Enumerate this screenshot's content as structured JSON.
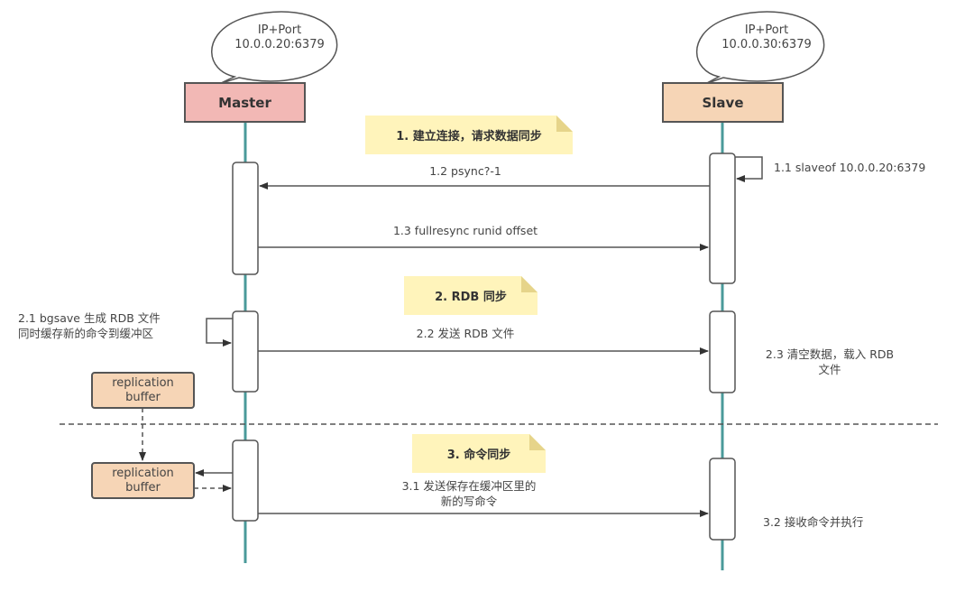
{
  "colors": {
    "master_fill": "#f2b8b5",
    "slave_fill": "#f6d5b6",
    "lifeline": "#4a9a9a",
    "note_fill": "#fff4bb",
    "buffer_fill": "#f6d5b6",
    "line": "#555555"
  },
  "actors": {
    "master": {
      "label": "Master",
      "bubble_line1": "IP+Port",
      "bubble_line2": "10.0.0.20:6379"
    },
    "slave": {
      "label": "Slave",
      "bubble_line1": "IP+Port",
      "bubble_line2": "10.0.0.30:6379"
    }
  },
  "phases": [
    {
      "label": "1. 建立连接，请求数据同步"
    },
    {
      "label": "2. RDB 同步"
    },
    {
      "label": "3. 命令同步"
    }
  ],
  "messages": {
    "m1_1": "1.1 slaveof 10.0.0.20:6379",
    "m1_2": "1.2 psync?-1",
    "m1_3": "1.3 fullresync runid offset",
    "m2_1_line1": "2.1 bgsave 生成 RDB 文件",
    "m2_1_line2": "同时缓存新的命令到缓冲区",
    "m2_2": "2.2 发送 RDB 文件",
    "m2_3_line1": "2.3 清空数据，载入 RDB",
    "m2_3_line2": "文件",
    "m3_1_line1": "3.1 发送保存在缓冲区里的",
    "m3_1_line2": "新的写命令",
    "m3_2": "3.2 接收命令并执行"
  },
  "buffers": [
    {
      "line1": "replication",
      "line2": "buffer"
    },
    {
      "line1": "replication",
      "line2": "buffer"
    }
  ]
}
